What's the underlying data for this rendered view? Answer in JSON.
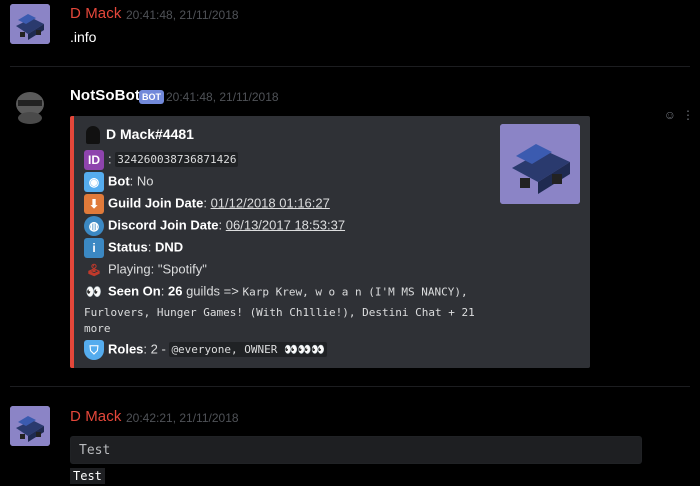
{
  "messages": {
    "m1": {
      "username": "D Mack",
      "timestamp": "20:41:48, 21/11/2018",
      "text": ".info"
    },
    "m2": {
      "username": "NotSoBot",
      "badge": "BOT",
      "timestamp": "20:41:48, 21/11/2018",
      "embed": {
        "author": "D Mack#4481",
        "id_value": "324260038736871426",
        "bot_label": "Bot",
        "bot_value": ": No",
        "guild_join_label": "Guild Join Date",
        "guild_join_value": "01/12/2018 01:16:27",
        "discord_join_label": "Discord Join Date",
        "discord_join_value": "06/13/2017 18:53:37",
        "status_label": "Status",
        "status_value": "DND",
        "playing": "Playing: \"Spotify\"",
        "seen_on_label": "Seen On",
        "seen_on_count": "26",
        "seen_on_suffix": "guilds =>",
        "seen_on_list_1": "Karp Krew, w o a n (I'M MS NANCY),",
        "seen_on_list_2": "Furlovers, Hunger Games! (With Ch1llie!), Destini Chat + 21",
        "seen_on_list_3": "more",
        "roles_label": "Roles",
        "roles_value": ": 2 -",
        "roles_list": "@everyone, OWNER 👀👀👀",
        "accent_color": "#e4473a"
      }
    },
    "m3": {
      "username": "D Mack",
      "timestamp": "20:42:21, 21/11/2018",
      "code_block": "Test",
      "inline_code": "Test"
    }
  },
  "colors": {
    "background": "#000000",
    "username_red": "#e4473a",
    "embed_bg": "#2f3136",
    "bot_badge": "#7289da"
  },
  "icons": [
    "truck-avatar",
    "ninja-avatar",
    "id-icon",
    "robot-icon",
    "inbox-icon",
    "globe-icon",
    "info-icon",
    "joystick-icon",
    "eyes-icon",
    "shield-icon",
    "add-reaction-icon",
    "more-icon"
  ]
}
